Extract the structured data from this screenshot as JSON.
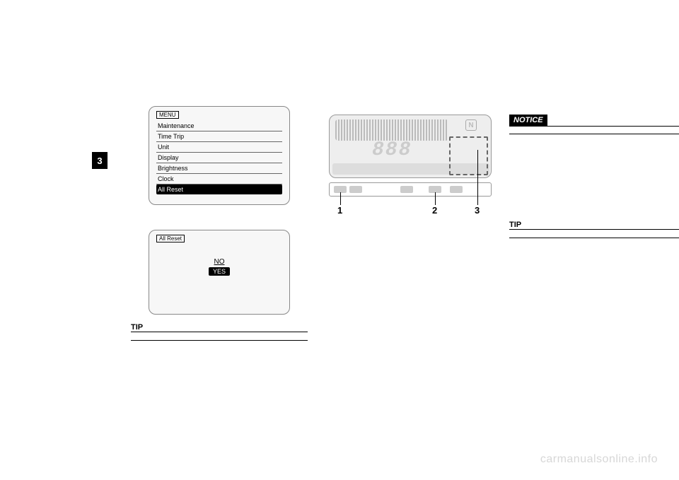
{
  "chapter": "3",
  "col1": {
    "menu_head": "MENU",
    "menu_items": [
      "Maintenance",
      "Time Trip",
      "Unit",
      "Display",
      "Brightness",
      "Clock",
      "All Reset"
    ],
    "confirm_head": "All Reset",
    "confirm_no": "NO",
    "confirm_yes": "YES",
    "tip_label": "TIP",
    "tip_body": ""
  },
  "col2": {
    "dash_888": "888",
    "dash_neutral": "N",
    "label1": "1",
    "label2": "2",
    "label3": "3"
  },
  "col3": {
    "notice_label": "NOTICE",
    "notice_body": "",
    "tip_label": "TIP",
    "tip_body": ""
  },
  "watermark": "carmanualsonline.info"
}
